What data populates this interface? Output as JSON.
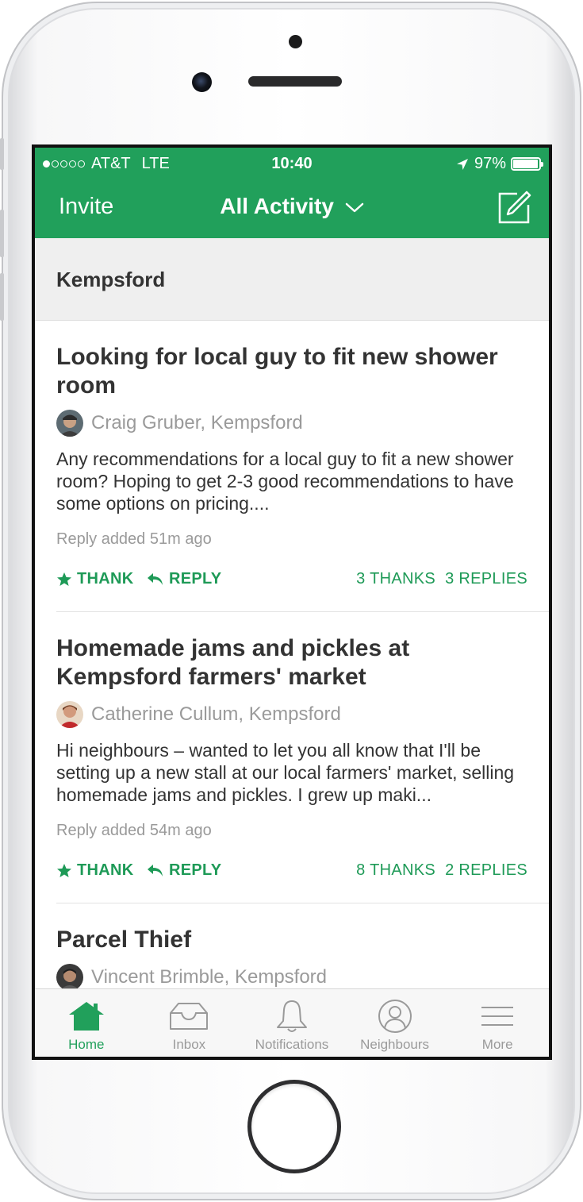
{
  "status_bar": {
    "carrier": "AT&T",
    "network": "LTE",
    "time": "10:40",
    "battery": "97%"
  },
  "nav": {
    "invite_label": "Invite",
    "title": "All Activity",
    "compose_icon": "compose-icon"
  },
  "location": {
    "name": "Kempsford"
  },
  "posts": [
    {
      "title": "Looking for local guy to fit new shower room",
      "author": "Craig Gruber, Kempsford",
      "body": "Any recommendations for a local guy to fit a new shower room? Hoping to get 2-3 good recommendations to have some options on pricing....",
      "meta": "Reply added 51m ago",
      "thank_label": "THANK",
      "reply_label": "REPLY",
      "thanks_count": "3 THANKS",
      "replies_count": "3 REPLIES"
    },
    {
      "title": "Homemade jams and pickles at Kempsford farmers' market",
      "author": "Catherine Cullum, Kempsford",
      "body": "Hi neighbours – wanted to let you all know that I'll be setting up a new stall at our local farmers' market, selling homemade jams and pickles. I grew up maki...",
      "meta": "Reply added 54m ago",
      "thank_label": "THANK",
      "reply_label": "REPLY",
      "thanks_count": "8 THANKS",
      "replies_count": "2 REPLIES"
    },
    {
      "title": "Parcel Thief",
      "author": "Vincent Brimble, Kempsford"
    }
  ],
  "tabs": [
    {
      "label": "Home",
      "icon": "home-icon",
      "active": true
    },
    {
      "label": "Inbox",
      "icon": "inbox-icon",
      "active": false
    },
    {
      "label": "Notifications",
      "icon": "bell-icon",
      "active": false
    },
    {
      "label": "Neighbours",
      "icon": "person-icon",
      "active": false
    },
    {
      "label": "More",
      "icon": "menu-icon",
      "active": false
    }
  ],
  "colors": {
    "brand_green": "#21a05b",
    "action_green": "#1e9a57",
    "muted_text": "#9a9a9a"
  }
}
